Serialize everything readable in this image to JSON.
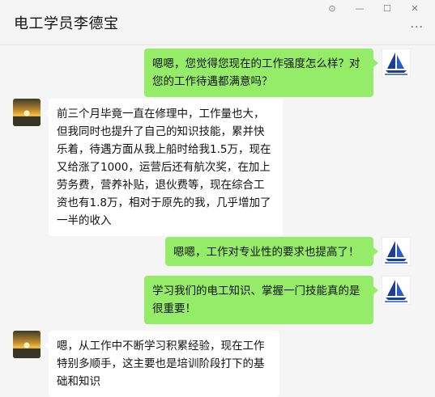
{
  "window": {
    "title": "电工学员李德宝",
    "controls": {
      "pin": "⊙",
      "minimize": "—",
      "maximize": "☐",
      "close": "✕",
      "more": "···"
    }
  },
  "messages": [
    {
      "side": "right",
      "text": "嗯嗯，您觉得您现在的工作强度怎么样？对您的工作待遇都满意吗？"
    },
    {
      "side": "left",
      "text": "前三个月毕竟一直在修理中，工作量也大，但我同时也提升了自己的知识技能，累并快乐着，待遇方面从我上船时给我1.5万，现在又给涨了1000，运营后还有航次奖，在加上劳务费，营养补贴，退伙费等，现在综合工资也有1.8万，相对于原先的我，几乎增加了一半的收入"
    },
    {
      "side": "right",
      "text": "嗯嗯，工作对专业性的要求也提高了！"
    },
    {
      "side": "right",
      "text": "学习我们的电工知识、掌握一门技能真的是很重要！"
    },
    {
      "side": "left",
      "text": "嗯，从工作中不断学习积累经验，现在工作特别多顺手，这主要也是培训阶段打下的基础和知识"
    }
  ],
  "colors": {
    "own_bubble": "#95ec69",
    "other_bubble": "#ffffff",
    "background": "#f5f5f5"
  }
}
